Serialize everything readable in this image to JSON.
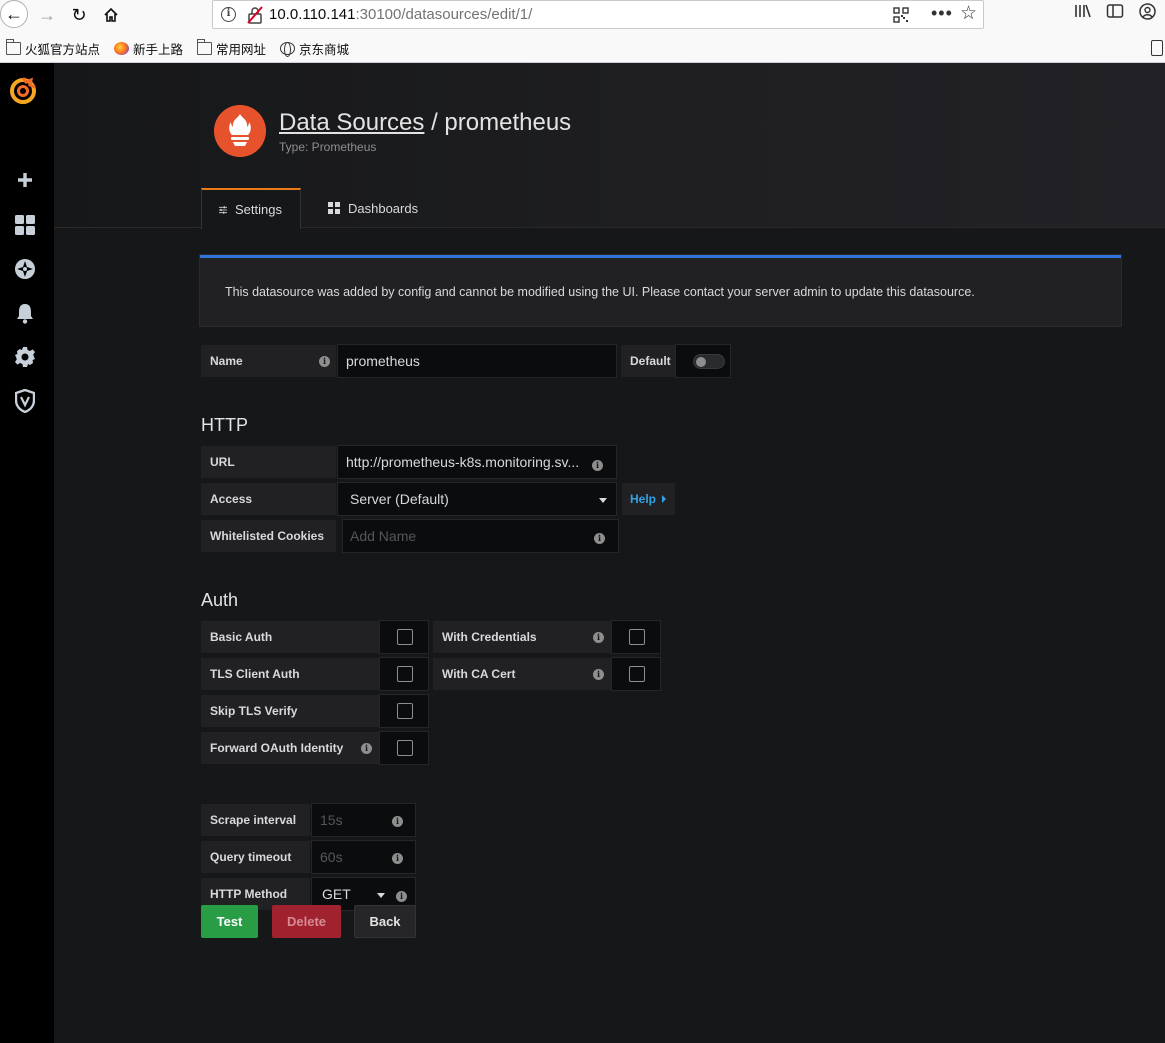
{
  "browser": {
    "url_host": "10.0.110.141",
    "url_path": ":30100/datasources/edit/1/",
    "bookmarks": [
      {
        "label": "火狐官方站点",
        "icon": "folder-icon"
      },
      {
        "label": "新手上路",
        "icon": "firefox-icon"
      },
      {
        "label": "常用网址",
        "icon": "folder-icon"
      },
      {
        "label": "京东商城",
        "icon": "globe-icon"
      }
    ]
  },
  "sidebar": {
    "items": [
      {
        "name": "create",
        "icon": "plus-icon"
      },
      {
        "name": "dashboards",
        "icon": "apps-icon"
      },
      {
        "name": "explore",
        "icon": "compass-icon"
      },
      {
        "name": "alerting",
        "icon": "bell-icon"
      },
      {
        "name": "configuration",
        "icon": "gear-icon"
      },
      {
        "name": "server-admin",
        "icon": "shield-icon"
      }
    ]
  },
  "header": {
    "breadcrumb_link": "Data Sources",
    "separator": " / ",
    "title": "prometheus",
    "subtitle": "Type: Prometheus"
  },
  "tabs": [
    {
      "label": "Settings",
      "active": true
    },
    {
      "label": "Dashboards",
      "active": false
    }
  ],
  "alert": {
    "text": "This datasource was added by config and cannot be modified using the UI. Please contact your server admin to update this datasource."
  },
  "name_row": {
    "label": "Name",
    "value": "prometheus",
    "default_label": "Default",
    "default_enabled": false
  },
  "http": {
    "title": "HTTP",
    "url_label": "URL",
    "url_value": "http://prometheus-k8s.monitoring.sv...",
    "access_label": "Access",
    "access_value": "Server (Default)",
    "help_label": "Help",
    "cookies_label": "Whitelisted Cookies",
    "cookies_placeholder": "Add Name"
  },
  "auth": {
    "title": "Auth",
    "basic_auth": "Basic Auth",
    "with_credentials": "With Credentials",
    "tls_client_auth": "TLS Client Auth",
    "with_ca_cert": "With CA Cert",
    "skip_tls_verify": "Skip TLS Verify",
    "forward_oauth": "Forward OAuth Identity"
  },
  "misc": {
    "scrape_label": "Scrape interval",
    "scrape_placeholder": "15s",
    "timeout_label": "Query timeout",
    "timeout_placeholder": "60s",
    "method_label": "HTTP Method",
    "method_value": "GET"
  },
  "buttons": {
    "test": "Test",
    "delete": "Delete",
    "back": "Back"
  },
  "colors": {
    "accent": "#eb7b18",
    "alert_border": "#3274d9",
    "test_button": "#299c46",
    "delete_button": "#a0222f",
    "prometheus_orange": "#e6522c"
  }
}
